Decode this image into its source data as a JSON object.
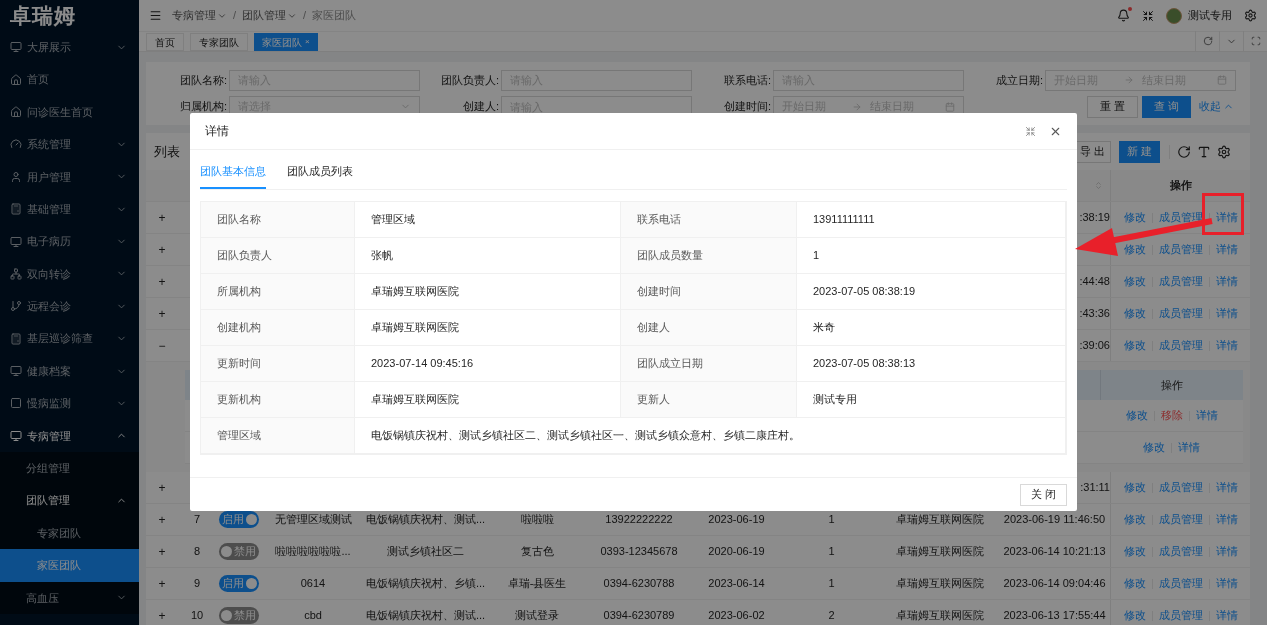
{
  "sidebar": {
    "logo": "卓瑞姆",
    "items": [
      {
        "label": "大屏展示",
        "expanded": false,
        "selected": false
      },
      {
        "label": "首页",
        "selected": false
      },
      {
        "label": "问诊医生首页",
        "selected": false
      },
      {
        "label": "系统管理",
        "expanded": false,
        "selected": false
      },
      {
        "label": "用户管理",
        "expanded": false,
        "selected": false
      },
      {
        "label": "基础管理",
        "expanded": false,
        "selected": false
      },
      {
        "label": "电子病历",
        "expanded": false,
        "selected": false
      },
      {
        "label": "双向转诊",
        "expanded": false,
        "selected": false
      },
      {
        "label": "远程会诊",
        "expanded": false,
        "selected": false
      },
      {
        "label": "基层巡诊筛查",
        "expanded": false,
        "selected": false
      },
      {
        "label": "健康档案",
        "expanded": false,
        "selected": false
      },
      {
        "label": "慢病监测",
        "expanded": false,
        "selected": false
      },
      {
        "label": "专病管理",
        "expanded": true,
        "selected": false,
        "children": [
          {
            "label": "分组管理",
            "selected": false
          },
          {
            "label": "团队管理",
            "expanded": true,
            "selected": false,
            "children": [
              {
                "label": "专家团队",
                "selected": false
              },
              {
                "label": "家医团队",
                "selected": true
              }
            ]
          },
          {
            "label": "高血压",
            "expanded": false,
            "selected": false
          }
        ]
      }
    ]
  },
  "header": {
    "breadcrumb": [
      {
        "label": "专病管理",
        "dropdown": true
      },
      {
        "separator": "/",
        "label": "团队管理",
        "dropdown": true
      },
      {
        "separator": "/",
        "label": "家医团队",
        "dropdown": false
      }
    ],
    "notifications": {
      "unread": true
    },
    "user": {
      "name": "测试专用"
    }
  },
  "page_tabs": [
    {
      "label": "首页",
      "selected": false
    },
    {
      "label": "专家团队",
      "selected": false
    },
    {
      "label": "家医团队",
      "selected": true,
      "close": "×"
    }
  ],
  "filters": {
    "fields": [
      {
        "label": "团队名称:",
        "kind": "text",
        "placeholder": "请输入"
      },
      {
        "label": "团队负责人:",
        "kind": "text",
        "placeholder": "请输入"
      },
      {
        "label": "联系电话:",
        "kind": "text",
        "placeholder": "请输入"
      },
      {
        "label": "成立日期:",
        "kind": "date_range",
        "start": "开始日期",
        "end": "结束日期"
      },
      {
        "label": "归属机构:",
        "kind": "select",
        "placeholder": "请选择"
      },
      {
        "label": "创建人:",
        "kind": "text",
        "placeholder": "请输入"
      },
      {
        "label": "创建时间:",
        "kind": "date_range",
        "start": "开始日期",
        "end": "结束日期"
      }
    ],
    "buttons": [
      {
        "label": "重 置",
        "kind": "default"
      },
      {
        "label": "查 询",
        "kind": "primary"
      },
      {
        "label": "收起",
        "kind": "link"
      }
    ]
  },
  "table": {
    "title": "列表",
    "buttons": [
      {
        "label": "导 出",
        "kind": "default"
      },
      {
        "label": "新 建",
        "kind": "primary"
      }
    ],
    "action_header": "操作",
    "rows": [
      {
        "kind": "covered",
        "expander": "+",
        "time": ":38:19",
        "actions": [
          "修改",
          "成员管理",
          "详情"
        ]
      },
      {
        "kind": "covered",
        "expander": "+",
        "actions": [
          "修改",
          "成员管理",
          "详情"
        ]
      },
      {
        "kind": "covered",
        "expander": "+",
        "time": ":44:48",
        "actions": [
          "修改",
          "成员管理",
          "详情"
        ]
      },
      {
        "kind": "covered",
        "expander": "+",
        "time": ":43:36",
        "actions": [
          "修改",
          "成员管理",
          "详情"
        ]
      },
      {
        "kind": "covered",
        "expander": "−",
        "time": ":39:06",
        "actions": [
          "修改",
          "成员管理",
          "详情"
        ],
        "expansion": {
          "header": "操作",
          "rows": [
            {
              "actions": [
                {
                  "label": "修改",
                  "kind": "link"
                },
                {
                  "label": "移除",
                  "kind": "danger"
                },
                {
                  "label": "详情",
                  "kind": "link"
                }
              ]
            },
            {
              "actions": [
                {
                  "label": "修改",
                  "kind": "link"
                },
                {
                  "label": "详情",
                  "kind": "link"
                }
              ]
            }
          ]
        }
      },
      {
        "kind": "covered",
        "expander": "+",
        "time": ":31:11",
        "actions": [
          "修改",
          "成员管理",
          "详情"
        ]
      },
      {
        "kind": "full",
        "expander": "+",
        "index": "7",
        "status": {
          "label": "启用",
          "on": true
        },
        "name": "无管理区域测试",
        "area": "电饭锅镇庆祝村、测试...",
        "leader": "啦啦啦",
        "phone": "13922222222",
        "date": "2023-06-19",
        "count": "1",
        "org": "卓瑞姆互联网医院",
        "time": "2023-06-19 11:46:50",
        "actions": [
          "修改",
          "成员管理",
          "详情"
        ]
      },
      {
        "kind": "full",
        "expander": "+",
        "index": "8",
        "status": {
          "label": "禁用",
          "on": false
        },
        "name": "啦啦啦啦啦啦...",
        "area": "测试乡镇社区二",
        "leader": "复古色",
        "phone": "0393-12345678",
        "date": "2020-06-19",
        "count": "1",
        "org": "卓瑞姆互联网医院",
        "time": "2023-06-14 10:21:13",
        "actions": [
          "修改",
          "成员管理",
          "详情"
        ]
      },
      {
        "kind": "full",
        "expander": "+",
        "index": "9",
        "status": {
          "label": "启用",
          "on": true
        },
        "name": "0614",
        "area": "电饭锅镇庆祝村、乡镇...",
        "leader": "卓瑞-县医生",
        "phone": "0394-6230788",
        "date": "2023-06-14",
        "count": "1",
        "org": "卓瑞姆互联网医院",
        "time": "2023-06-14 09:04:46",
        "actions": [
          "修改",
          "成员管理",
          "详情"
        ]
      },
      {
        "kind": "full",
        "expander": "+",
        "index": "10",
        "status": {
          "label": "禁用",
          "on": false
        },
        "name": "cbd",
        "area": "电饭锅镇庆祝村、测试...",
        "leader": "测试登录",
        "phone": "0394-6230789",
        "date": "2023-06-02",
        "count": "2",
        "org": "卓瑞姆互联网医院",
        "time": "2023-06-13 17:55:44",
        "actions": [
          "修改",
          "成员管理",
          "详情"
        ]
      }
    ]
  },
  "modal": {
    "title": "详情",
    "tabs": [
      {
        "label": "团队基本信息",
        "selected": true
      },
      {
        "label": "团队成员列表",
        "selected": false
      }
    ],
    "details": [
      {
        "label": "团队名称",
        "value": "管理区域",
        "kind": "half"
      },
      {
        "label": "联系电话",
        "value": "13911111111",
        "kind": "half"
      },
      {
        "label": "团队负责人",
        "value": "张帆",
        "kind": "half"
      },
      {
        "label": "团队成员数量",
        "value": "1",
        "kind": "half"
      },
      {
        "label": "所属机构",
        "value": "卓瑞姆互联网医院",
        "kind": "half"
      },
      {
        "label": "创建时间",
        "value": "2023-07-05 08:38:19",
        "kind": "half"
      },
      {
        "label": "创建机构",
        "value": "卓瑞姆互联网医院",
        "kind": "half"
      },
      {
        "label": "创建人",
        "value": "米奇",
        "kind": "half"
      },
      {
        "label": "更新时间",
        "value": "2023-07-14 09:45:16",
        "kind": "half"
      },
      {
        "label": "团队成立日期",
        "value": "2023-07-05 08:38:13",
        "kind": "half"
      },
      {
        "label": "更新机构",
        "value": "卓瑞姆互联网医院",
        "kind": "half"
      },
      {
        "label": "更新人",
        "value": "测试专用",
        "kind": "half"
      },
      {
        "label": "管理区域",
        "value": "电饭锅镇庆祝村、测试乡镇社区二、测试乡镇社区一、测试乡镇众意村、乡镇二康庄村。",
        "kind": "full"
      }
    ],
    "close_button": "关 闭"
  }
}
